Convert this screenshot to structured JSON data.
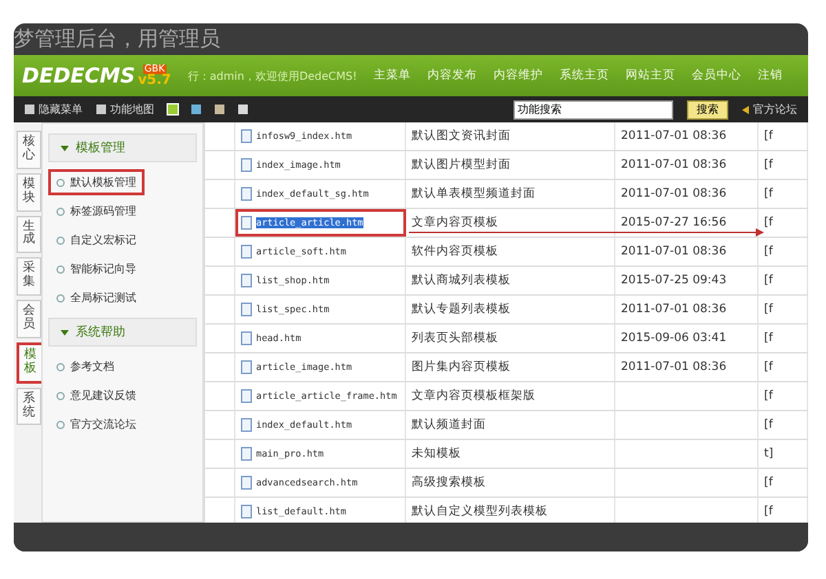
{
  "caption": "梦管理后台，用管理员",
  "header": {
    "logo": "DEDECMS",
    "version": "v5.7",
    "edition": "GBK",
    "welcome": "行：admin，欢迎使用DedeCMS!",
    "nav": [
      "主菜单",
      "内容发布",
      "内容维护",
      "系统主页",
      "网站主页",
      "会员中心",
      "注销"
    ]
  },
  "toolbar": {
    "links": [
      "隐藏菜单",
      "功能地图"
    ],
    "swatches": [
      {
        "color": "#9acd32",
        "selected": true
      },
      {
        "color": "#6ab0d8",
        "selected": false
      },
      {
        "color": "#c8b89a",
        "selected": false
      },
      {
        "color": "#d8d8d8",
        "selected": false
      }
    ],
    "search": {
      "value": "功能搜索",
      "button": "搜索"
    },
    "forum": "官方论坛"
  },
  "side_tabs": [
    {
      "label": "核心",
      "selected": false
    },
    {
      "label": "模块",
      "selected": false
    },
    {
      "label": "生成",
      "selected": false
    },
    {
      "label": "采集",
      "selected": false
    },
    {
      "label": "会员",
      "selected": false
    },
    {
      "label": "模板",
      "selected": true
    },
    {
      "label": "系统",
      "selected": false
    }
  ],
  "menu": [
    {
      "title": "模板管理",
      "items": [
        {
          "label": "默认模板管理",
          "highlighted": true
        },
        {
          "label": "标签源码管理",
          "highlighted": false
        },
        {
          "label": "自定义宏标记",
          "highlighted": false
        },
        {
          "label": "智能标记向导",
          "highlighted": false
        },
        {
          "label": "全局标记测试",
          "highlighted": false
        }
      ]
    },
    {
      "title": "系统帮助",
      "items": [
        {
          "label": "参考文档",
          "highlighted": false
        },
        {
          "label": "意见建议反馈",
          "highlighted": false
        },
        {
          "label": "官方交流论坛",
          "highlighted": false
        }
      ]
    }
  ],
  "table": {
    "rows": [
      {
        "file": "infosw9_index.htm",
        "desc": "默认图文资讯封面",
        "date": "2011-07-01 08:36",
        "action": "[f",
        "selected": false
      },
      {
        "file": "index_image.htm",
        "desc": "默认图片模型封面",
        "date": "2011-07-01 08:36",
        "action": "[f",
        "selected": false
      },
      {
        "file": "index_default_sg.htm",
        "desc": "默认单表模型频道封面",
        "date": "2011-07-01 08:36",
        "action": "[f",
        "selected": false
      },
      {
        "file": "article_article.htm",
        "desc": "文章内容页模板",
        "date": "2015-07-27 16:56",
        "action": "[f",
        "selected": true
      },
      {
        "file": "article_soft.htm",
        "desc": "软件内容页模板",
        "date": "2011-07-01 08:36",
        "action": "[f",
        "selected": false
      },
      {
        "file": "list_shop.htm",
        "desc": "默认商城列表模板",
        "date": "2015-07-25 09:43",
        "action": "[f",
        "selected": false
      },
      {
        "file": "list_spec.htm",
        "desc": "默认专题列表模板",
        "date": "2011-07-01 08:36",
        "action": "[f",
        "selected": false
      },
      {
        "file": "head.htm",
        "desc": "列表页头部模板",
        "date": "2015-09-06 03:41",
        "action": "[f",
        "selected": false
      },
      {
        "file": "article_image.htm",
        "desc": "图片集内容页模板",
        "date": "2011-07-01 08:36",
        "action": "[f",
        "selected": false
      },
      {
        "file": "article_article_frame.htm",
        "desc": "文章内容页模板框架版",
        "action": "[f",
        "selected": false
      },
      {
        "file": "index_default.htm",
        "desc": "默认频道封面",
        "action": "[f",
        "selected": false
      },
      {
        "file": "main_pro.htm",
        "desc": "未知模板",
        "action": "t]",
        "selected": false
      },
      {
        "file": "advancedsearch.htm",
        "desc": "高级搜索模板",
        "action": "[f",
        "selected": false
      },
      {
        "file": "list_default.htm",
        "desc": "默认自定义模型列表模板",
        "action": "[f",
        "selected": false
      }
    ]
  }
}
